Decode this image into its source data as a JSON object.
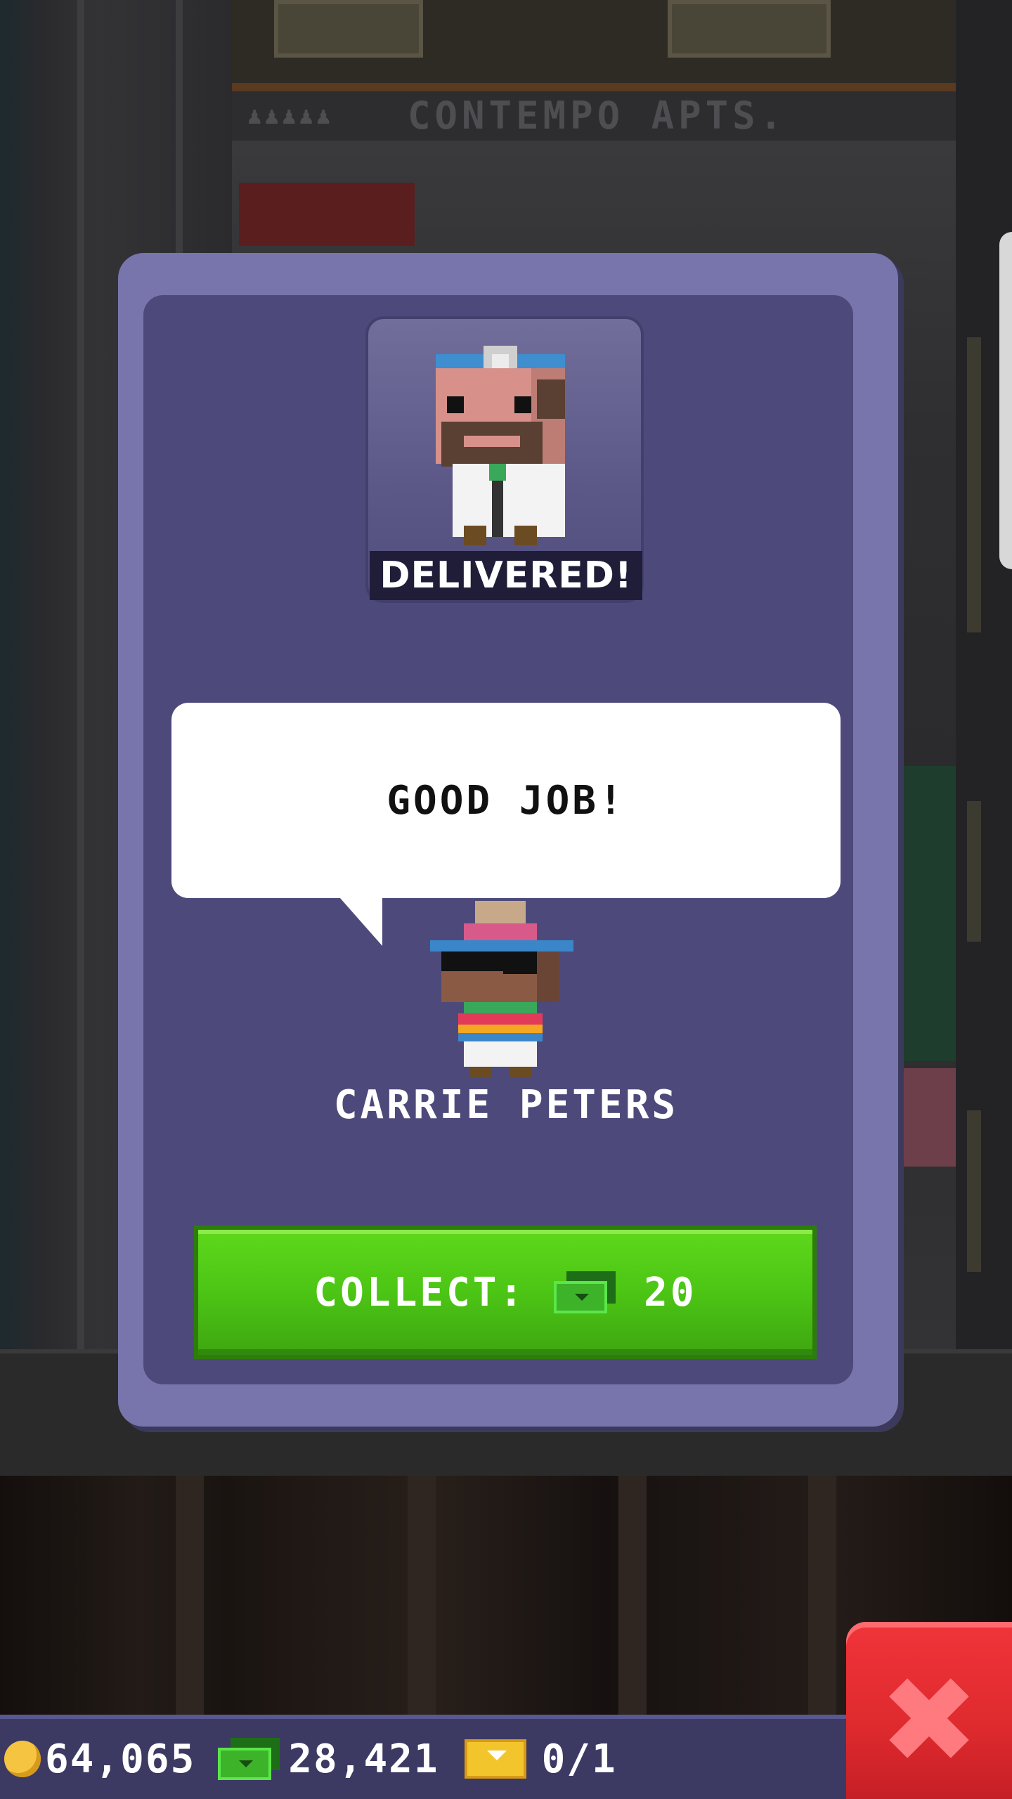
{
  "background": {
    "floor_sign": "CONTEMPO APTS."
  },
  "modal": {
    "status_banner": "DELIVERED!",
    "speech_text": "GOOD JOB!",
    "customer_name": "CARRIE PETERS",
    "collect_label": "COLLECT:",
    "collect_amount": "20"
  },
  "hud": {
    "coins": "64,065",
    "bux": "28,421",
    "tickets": "0/1"
  },
  "icons": {
    "close": "close-icon",
    "coin": "coin-icon",
    "bux": "bux-icon",
    "ticket": "ticket-icon"
  },
  "colors": {
    "collect_button": "#4cc515",
    "close_button": "#de2a2e",
    "card": "#7875ad",
    "card_inner": "#4d4a7b"
  }
}
